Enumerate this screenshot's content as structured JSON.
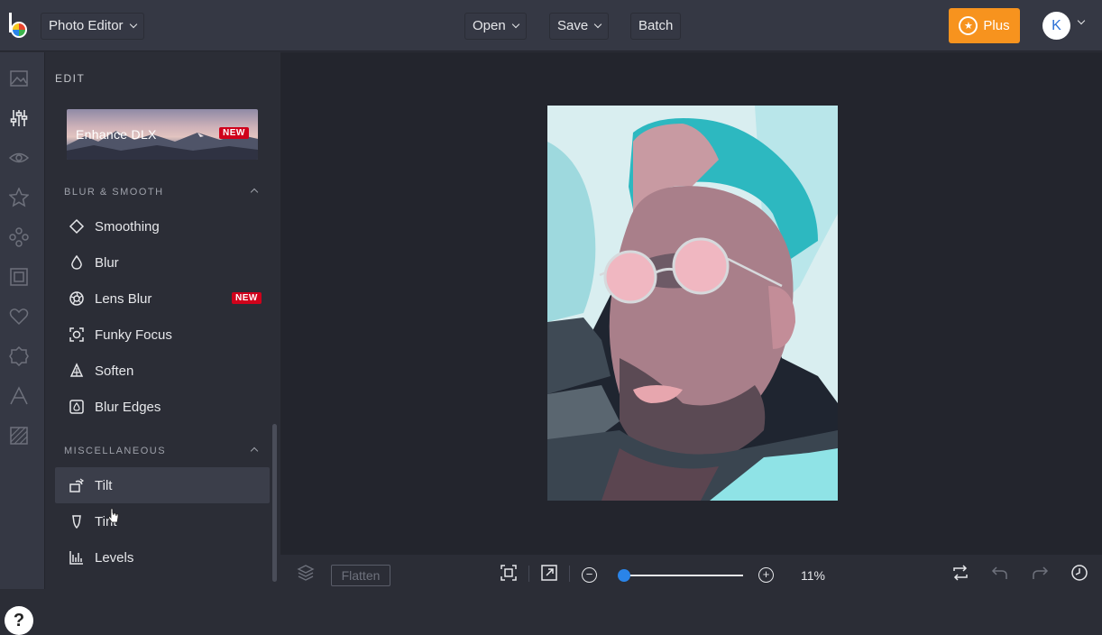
{
  "header": {
    "app_menu_label": "Photo Editor",
    "open_label": "Open",
    "save_label": "Save",
    "batch_label": "Batch",
    "plus_label": "Plus",
    "avatar_initial": "K"
  },
  "rail": {
    "icons": [
      "image-icon",
      "sliders-icon",
      "eye-icon",
      "star-icon",
      "circles-icon",
      "frame-icon",
      "heart-icon",
      "badge-icon",
      "text-icon",
      "texture-icon"
    ],
    "active": "sliders-icon",
    "help_label": "?"
  },
  "panel": {
    "title": "EDIT",
    "enhance": {
      "label": "Enhance DLX",
      "badge": "NEW"
    },
    "sections": [
      {
        "title": "BLUR & SMOOTH",
        "items": [
          {
            "label": "Smoothing",
            "icon": "diamond-icon"
          },
          {
            "label": "Blur",
            "icon": "drop-icon"
          },
          {
            "label": "Lens Blur",
            "icon": "aperture-icon",
            "badge": "NEW"
          },
          {
            "label": "Funky Focus",
            "icon": "focus-icon"
          },
          {
            "label": "Soften",
            "icon": "soften-icon"
          },
          {
            "label": "Blur Edges",
            "icon": "blur-edges-icon"
          }
        ]
      },
      {
        "title": "MISCELLANEOUS",
        "items": [
          {
            "label": "Tilt",
            "icon": "tilt-icon",
            "active": true
          },
          {
            "label": "Tint",
            "icon": "tint-icon"
          },
          {
            "label": "Levels",
            "icon": "levels-icon"
          }
        ]
      }
    ]
  },
  "bottom": {
    "flatten_label": "Flatten",
    "zoom_value": "11%",
    "zoom_fraction": 0.04
  },
  "colors": {
    "accent": "#f7931e",
    "slider": "#2a84e8",
    "badge": "#d0021b"
  }
}
